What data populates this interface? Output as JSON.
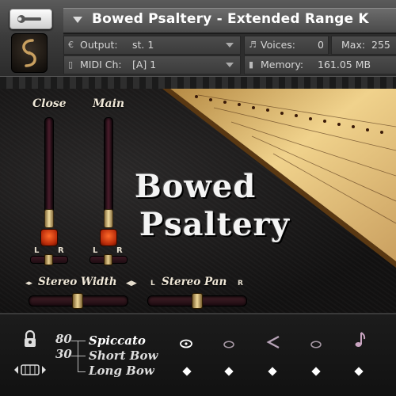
{
  "header": {
    "title": "Bowed Psaltery - Extended Range K",
    "output_label": "Output:",
    "output_value": "st. 1",
    "midi_label": "MIDI Ch:",
    "midi_value": "[A]  1",
    "voices_label": "Voices:",
    "voices_value": "0",
    "max_label": "Max:",
    "max_value": "255",
    "memory_label": "Memory:",
    "memory_value": "161.05 MB"
  },
  "mixer": {
    "close_label": "Close",
    "main_label": "Main",
    "close_level": 0.0,
    "main_level": 0.0,
    "stereo_width_label": "Stereo Width",
    "stereo_pan_label": "Stereo Pan",
    "l_label": "L",
    "r_label": "R"
  },
  "instrument": {
    "title_line1": "Bowed",
    "title_line2": "Psaltery"
  },
  "articulations": {
    "velocities": [
      "80",
      "30"
    ],
    "items": [
      "Spiccato",
      "Short Bow",
      "Long Bow"
    ],
    "slot_icons": [
      "eye-icon",
      "dim-eye-icon",
      "less-than-icon",
      "dim-eye-icon",
      "note-icon"
    ]
  },
  "colors": {
    "accent": "#e04010",
    "fader_track": "#4a1d2c",
    "gold": "#e8cf90"
  }
}
